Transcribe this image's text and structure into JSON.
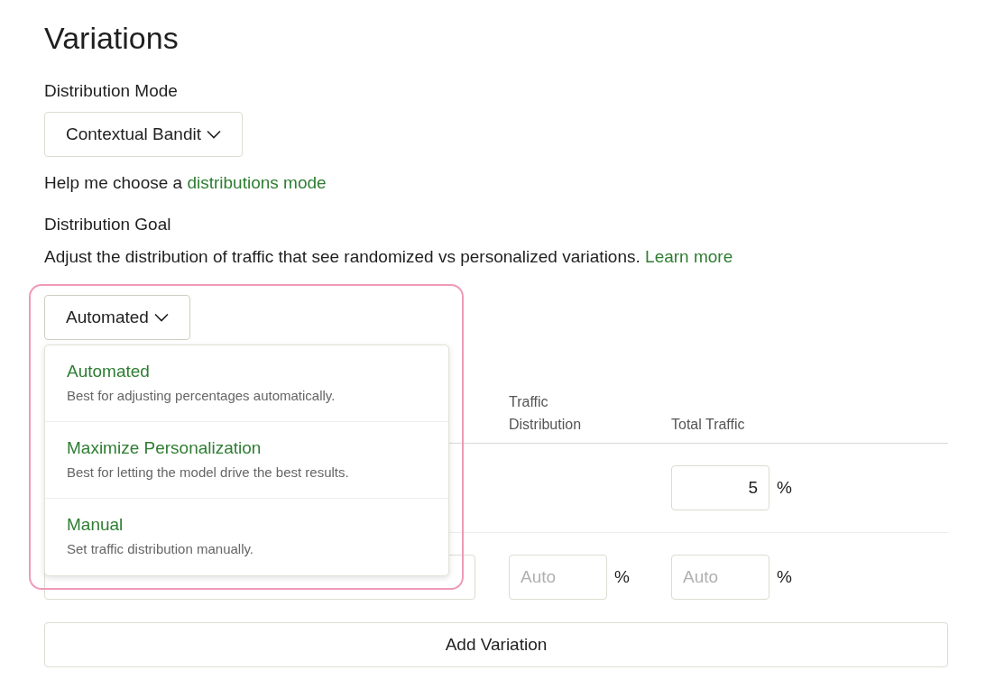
{
  "page_title": "Variations",
  "distribution_mode": {
    "label": "Distribution Mode",
    "value": "Contextual Bandit"
  },
  "help": {
    "text": "Help me choose a",
    "link": "distributions mode"
  },
  "distribution_goal": {
    "label": "Distribution Goal",
    "description": "Adjust the distribution of traffic that see randomized vs personalized variations.",
    "link": "Learn more",
    "value": "Automated",
    "expanded": true,
    "options": [
      {
        "title": "Automated",
        "description": "Best for adjusting percentages automatically."
      },
      {
        "title": "Maximize Personalization",
        "description": "Best for letting the model drive the best results."
      },
      {
        "title": "Manual",
        "description": "Set traffic distribution manually."
      }
    ]
  },
  "table": {
    "columns": [
      {
        "label": "Traffic Distribution"
      },
      {
        "label": "Total Traffic"
      }
    ],
    "rows": [
      {
        "kind": "control",
        "total_traffic": {
          "value": "5",
          "unit": "%"
        }
      },
      {
        "kind": "variation",
        "traffic_distribution": {
          "placeholder": "Auto",
          "unit": "%"
        },
        "total_traffic": {
          "placeholder": "Auto",
          "unit": "%"
        }
      }
    ]
  },
  "add_button": "Add Variation"
}
